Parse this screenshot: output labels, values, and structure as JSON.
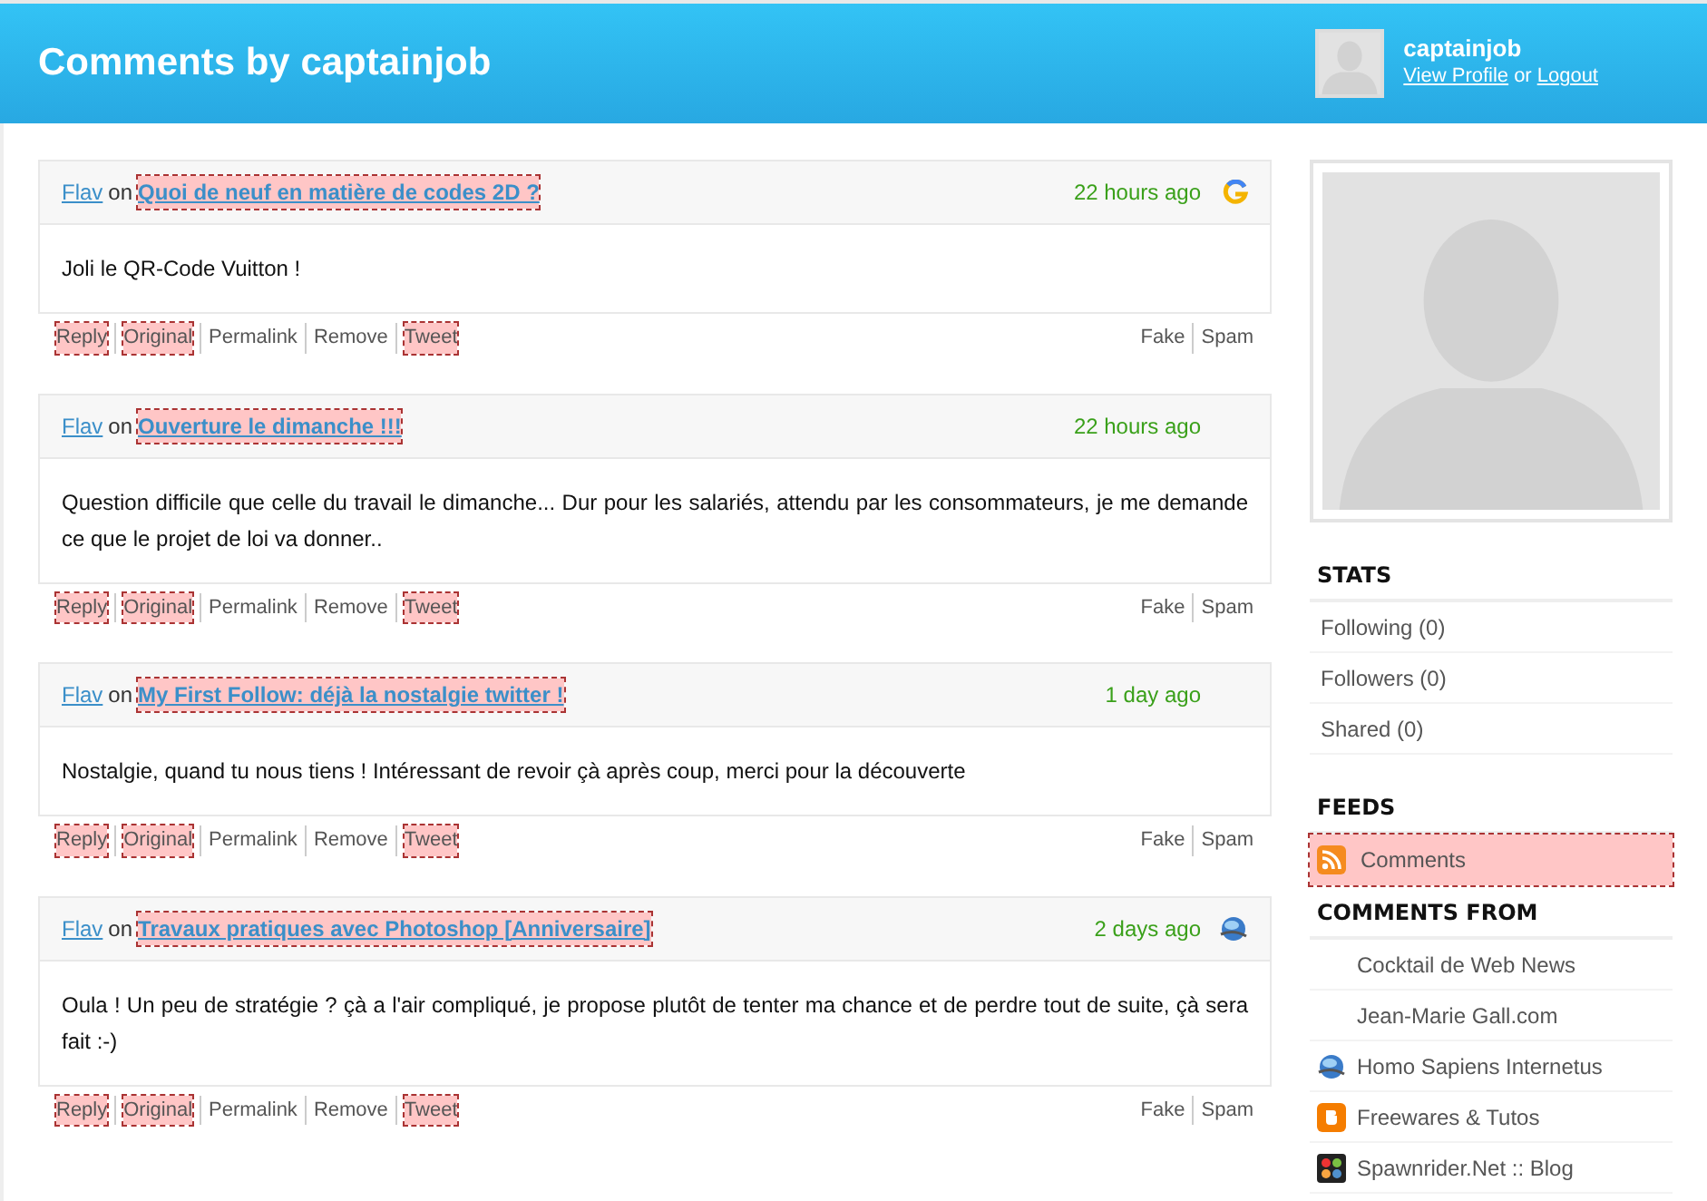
{
  "header": {
    "title": "Comments by captainjob",
    "username": "captainjob",
    "view_profile": "View Profile",
    "or": "or",
    "logout": "Logout"
  },
  "comments": [
    {
      "author": "Flav",
      "on": "on",
      "title": "Quoi de neuf en matière de codes 2D ?",
      "title_highlighted": true,
      "time": "22 hours ago",
      "kind": "g",
      "body": "Joli le QR-Code Vuitton !",
      "actions": [
        {
          "label": "Reply",
          "highlighted": true
        },
        {
          "label": "Original",
          "highlighted": true
        },
        {
          "label": "Permalink",
          "highlighted": false
        },
        {
          "label": "Remove",
          "highlighted": false
        },
        {
          "label": "Tweet",
          "highlighted": true
        }
      ],
      "flags": [
        "Fake",
        "Spam"
      ]
    },
    {
      "author": "Flav",
      "on": "on",
      "title": "Ouverture le dimanche !!!",
      "title_highlighted": true,
      "time": "22 hours ago",
      "kind": "none",
      "body": "Question difficile que celle du travail le dimanche... Dur pour les salariés, attendu par les consommateurs, je me demande ce que le projet de loi va donner..",
      "actions": [
        {
          "label": "Reply",
          "highlighted": true
        },
        {
          "label": "Original",
          "highlighted": true
        },
        {
          "label": "Permalink",
          "highlighted": false
        },
        {
          "label": "Remove",
          "highlighted": false
        },
        {
          "label": "Tweet",
          "highlighted": true
        }
      ],
      "flags": [
        "Fake",
        "Spam"
      ]
    },
    {
      "author": "Flav",
      "on": "on",
      "title": "My First Follow: déjà la nostalgie twitter !",
      "title_highlighted": true,
      "time": "1 day ago",
      "kind": "none",
      "body": "Nostalgie, quand tu nous tiens ! Intéressant de revoir çà après coup, merci pour la découverte",
      "actions": [
        {
          "label": "Reply",
          "highlighted": true
        },
        {
          "label": "Original",
          "highlighted": true
        },
        {
          "label": "Permalink",
          "highlighted": false
        },
        {
          "label": "Remove",
          "highlighted": false
        },
        {
          "label": "Tweet",
          "highlighted": true
        }
      ],
      "flags": [
        "Fake",
        "Spam"
      ]
    },
    {
      "author": "Flav",
      "on": "on",
      "title": "Travaux pratiques avec Photoshop [Anniversaire]",
      "title_highlighted": true,
      "time": "2 days ago",
      "kind": "globe",
      "body": "Oula ! Un peu de stratégie ? çà a l'air compliqué, je propose plutôt de tenter ma chance et de perdre tout de suite, çà sera fait :-)",
      "actions": [
        {
          "label": "Reply",
          "highlighted": true
        },
        {
          "label": "Original",
          "highlighted": true
        },
        {
          "label": "Permalink",
          "highlighted": false
        },
        {
          "label": "Remove",
          "highlighted": false
        },
        {
          "label": "Tweet",
          "highlighted": true
        }
      ],
      "flags": [
        "Fake",
        "Spam"
      ]
    }
  ],
  "sidebar": {
    "stats": {
      "heading": "STATS",
      "items": [
        "Following (0)",
        "Followers (0)",
        "Shared (0)"
      ]
    },
    "feeds": {
      "heading": "FEEDS",
      "items": [
        {
          "label": "Comments",
          "highlighted": true
        }
      ]
    },
    "comments_from": {
      "heading": "COMMENTS FROM",
      "items": [
        {
          "label": "Cocktail de Web News",
          "kind": "none"
        },
        {
          "label": "Jean-Marie Gall.com",
          "kind": "none"
        },
        {
          "label": "Homo Sapiens Internetus",
          "kind": "globe"
        },
        {
          "label": "Freewares & Tutos",
          "kind": "blogger"
        },
        {
          "label": "Spawnrider.Net :: Blog",
          "kind": "joomla"
        }
      ]
    }
  }
}
